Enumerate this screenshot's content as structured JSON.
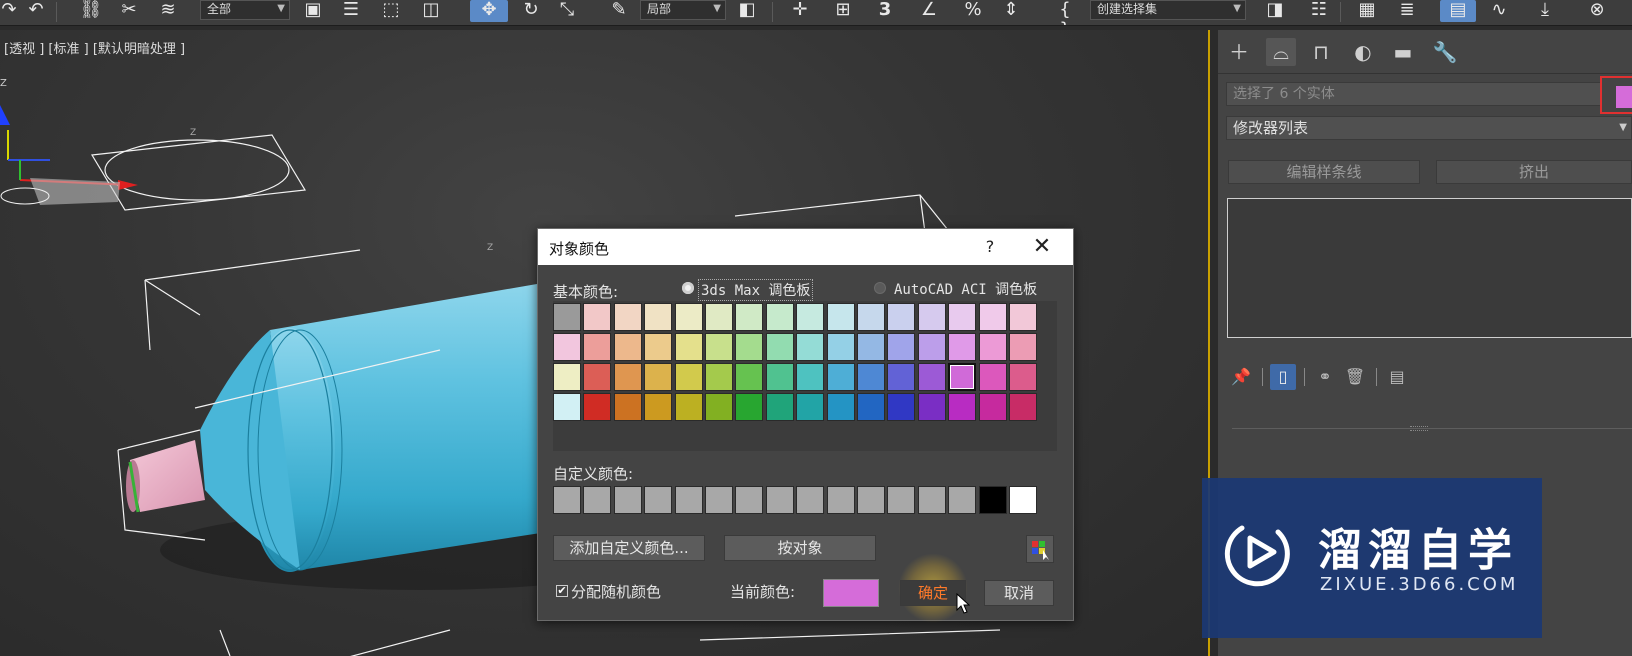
{
  "toolbar": {
    "filter_dropdown": "全部",
    "coord_dropdown": "局部",
    "snap_label": "3",
    "selection_set_dropdown": "创建选择集"
  },
  "viewport": {
    "label": "[透视 ] [标准 ] [默认明暗处理 ]"
  },
  "command_panel": {
    "tabs": [
      "create-icon",
      "modify-icon",
      "hierarchy-icon",
      "motion-icon",
      "display-icon",
      "utilities-icon"
    ],
    "selection_text": "选择了 6 个实体",
    "object_color": "#d56cd9",
    "modifier_list": "修改器列表",
    "btn_edit_spline": "编辑样条线",
    "btn_extrude": "挤出"
  },
  "dialog": {
    "title": "对象颜色",
    "help": "?",
    "close": "✕",
    "basic_colors_label": "基本颜色:",
    "radio_max": "3ds Max 调色板",
    "radio_autocad": "AutoCAD ACI 调色板",
    "custom_colors_label": "自定义颜色:",
    "add_custom_btn": "添加自定义颜色...",
    "by_object_btn": "按对象",
    "random_colors_checkbox": "分配随机颜色",
    "current_color_label": "当前颜色:",
    "current_color": "#d56cd9",
    "ok_btn": "确定",
    "cancel_btn": "取消",
    "basic_palette": [
      [
        "#9a9a9a",
        "#f2c8c8",
        "#f2d6c4",
        "#f0e2c4",
        "#ecebc6",
        "#e0eac4",
        "#d0eac6",
        "#c6eacc",
        "#c6eae0",
        "#c6e6ec",
        "#c6d8ec",
        "#cad0ee",
        "#d6caee",
        "#e8caee",
        "#f0caea",
        "#f2c8d8"
      ],
      [
        "#f2c6de",
        "#ec9e9a",
        "#edb88c",
        "#eccb8c",
        "#e4e08c",
        "#c8e08c",
        "#a4dc8e",
        "#92dcb0",
        "#94dcd6",
        "#94d0e6",
        "#94b8e4",
        "#a0a4ea",
        "#bc9eea",
        "#e09ae8",
        "#ec9ad6",
        "#ec9cb4"
      ],
      [
        "#eeeec4",
        "#dc5e56",
        "#df9650",
        "#dcb24c",
        "#d2ca4c",
        "#a4ca4c",
        "#66c250",
        "#50c290",
        "#4ec2c0",
        "#4eaed6",
        "#4e88d4",
        "#6262d6",
        "#9c5ad6",
        "#d06ad8",
        "#dc58bc",
        "#dc5c8c"
      ],
      [
        "#d2f0f4",
        "#d02c24",
        "#cc7222",
        "#cc9a20",
        "#bcb022",
        "#82b022",
        "#28a630",
        "#20a47a",
        "#22a4a6",
        "#2494c4",
        "#2266c2",
        "#3038c4",
        "#7a2ec4",
        "#b82cc2",
        "#c62a9e",
        "#c82c66"
      ]
    ],
    "custom_palette": [
      "#a8a8a8",
      "#a8a8a8",
      "#a8a8a8",
      "#a8a8a8",
      "#a8a8a8",
      "#a8a8a8",
      "#a8a8a8",
      "#a8a8a8",
      "#a8a8a8",
      "#a8a8a8",
      "#a8a8a8",
      "#a8a8a8",
      "#a8a8a8",
      "#a8a8a8",
      "#000000",
      "#ffffff"
    ],
    "selected_swatch": [
      2,
      13
    ]
  },
  "watermark": {
    "title": "溜溜自学",
    "subtitle": "ZIXUE.3D66.COM"
  }
}
